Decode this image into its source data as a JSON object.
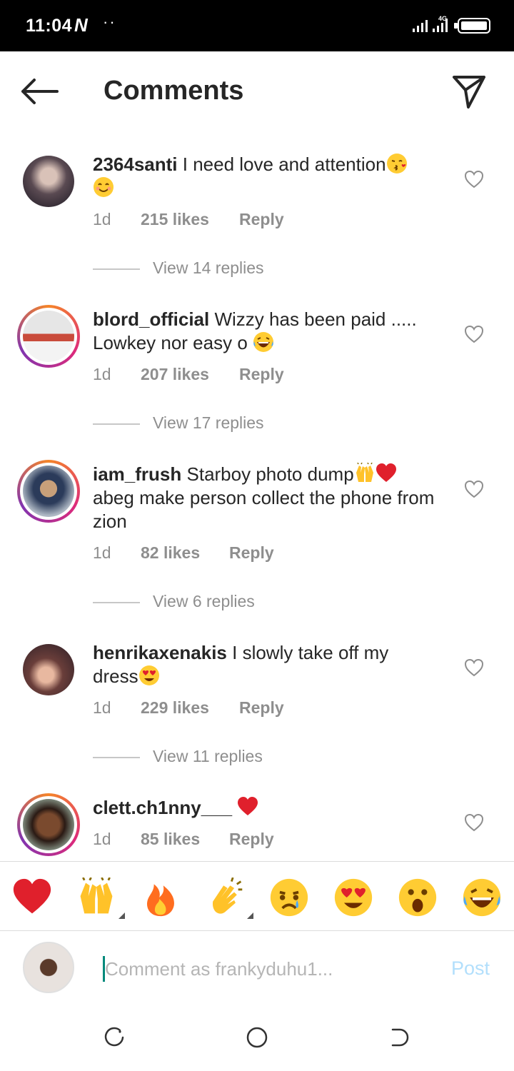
{
  "status_bar": {
    "time": "11:04",
    "carrier_icon": "N",
    "network": "4G"
  },
  "header": {
    "title": "Comments"
  },
  "comments": [
    {
      "username": "2364santi",
      "text": "I need love and attention",
      "emojis": [
        "kissing-face-emoji",
        "smiling-face-emoji"
      ],
      "age": "1d",
      "likes": "215 likes",
      "reply": "Reply",
      "view_replies": "View 14 replies",
      "has_story": false
    },
    {
      "username": "blord_official",
      "text": "Wizzy has been paid ..... Lowkey nor easy o",
      "emojis": [
        "laughing-tears-emoji"
      ],
      "age": "1d",
      "likes": "207 likes",
      "reply": "Reply",
      "view_replies": "View 17 replies",
      "has_story": true
    },
    {
      "username": "iam_frush",
      "text_before": "Starboy photo dump",
      "text_after": "abeg make person collect the phone from zion",
      "emojis": [
        "raising-hands-emoji",
        "red-heart-emoji"
      ],
      "age": "1d",
      "likes": "82 likes",
      "reply": "Reply",
      "view_replies": "View 6 replies",
      "has_story": true
    },
    {
      "username": "henrikaxenakis",
      "text": "I slowly take off my dress",
      "emojis": [
        "heart-eyes-emoji"
      ],
      "age": "1d",
      "likes": "229 likes",
      "reply": "Reply",
      "view_replies": "View 11 replies",
      "has_story": false
    },
    {
      "username": "clett.ch1nny___",
      "text": "",
      "emojis": [
        "red-heart-emoji"
      ],
      "age": "1d",
      "likes": "85 likes",
      "reply": "Reply",
      "has_story": true
    }
  ],
  "reactions": [
    "red-heart",
    "raising-hands",
    "fire",
    "clapping-hands",
    "crying-face",
    "heart-eyes",
    "surprised-face",
    "laughing-tears"
  ],
  "composer": {
    "placeholder": "Comment as frankyduhu1...",
    "post_label": "Post"
  },
  "colors": {
    "accent_disabled": "#b2dffc",
    "secondary_text": "#8e8e8e",
    "heart_red": "#e0202c"
  }
}
